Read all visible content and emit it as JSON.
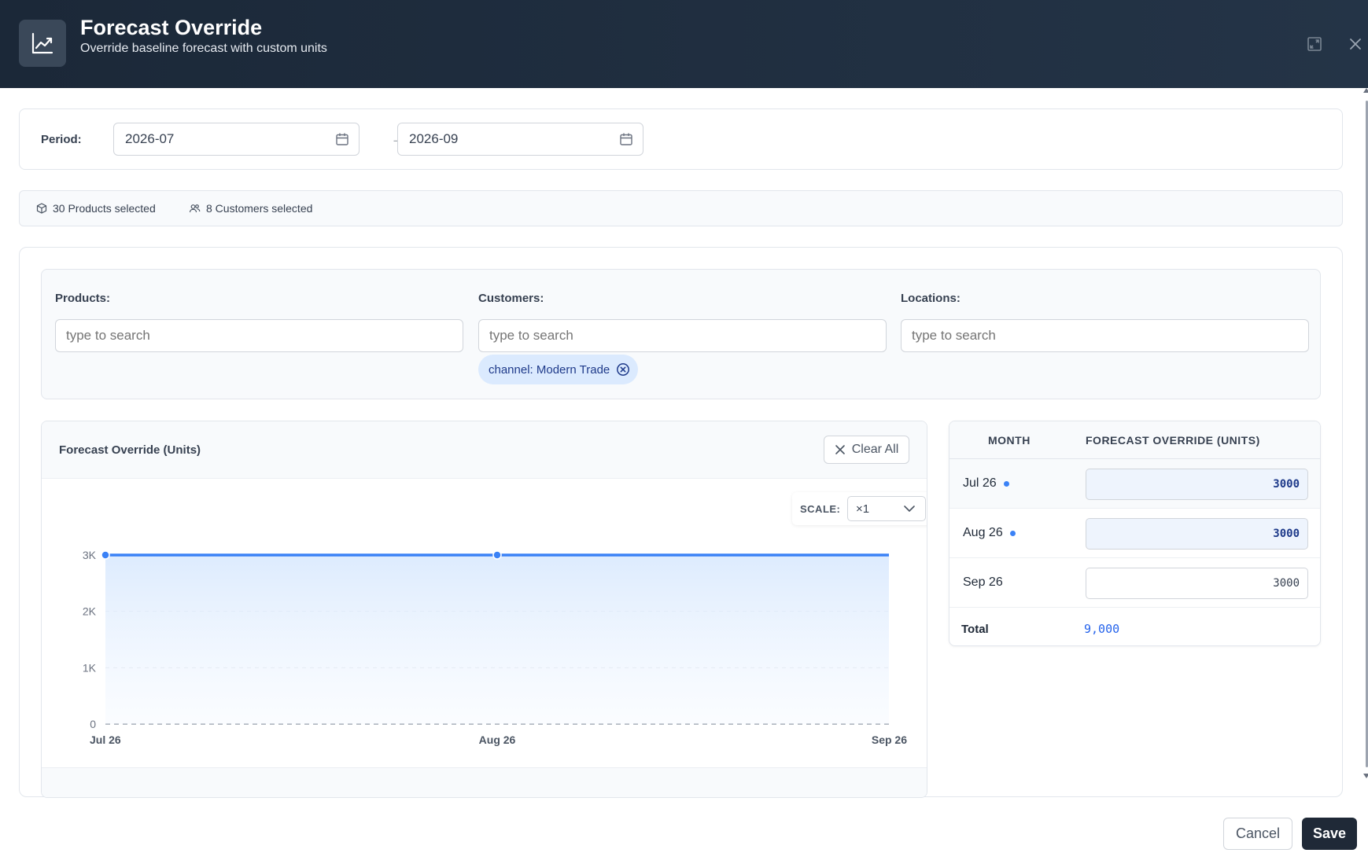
{
  "header": {
    "title": "Forecast Override",
    "subtitle": "Override baseline forecast with custom units",
    "icon": "trending-up-chart-icon",
    "actions": [
      "expand-icon",
      "close-icon"
    ]
  },
  "period": {
    "label": "Period:",
    "start": "2026-07",
    "arrow": "→",
    "end": "2026-09"
  },
  "selection": {
    "products": "30 Products selected",
    "customers": "8 Customers selected"
  },
  "filters": {
    "products": {
      "label": "Products:",
      "placeholder": "type to search"
    },
    "customers": {
      "label": "Customers:",
      "placeholder": "type to search",
      "chip": "channel: Modern Trade"
    },
    "locations": {
      "label": "Locations:",
      "placeholder": "type to search"
    }
  },
  "chart": {
    "title": "Forecast Override (Units)",
    "clear_label": "Clear All",
    "scale_label": "SCALE:",
    "scale_value": "×1",
    "y_tick_labels": [
      "0",
      "1K",
      "2K",
      "3K"
    ]
  },
  "chart_data": {
    "type": "area",
    "categories": [
      "Jul 26",
      "Aug 26",
      "Sep 26"
    ],
    "series": [
      {
        "values": [
          3000,
          3000,
          3000
        ]
      }
    ],
    "title": "Forecast Override (Units)",
    "ylim": [
      0,
      3000
    ],
    "y_ticks": [
      0,
      1000,
      2000,
      3000
    ],
    "grid": true,
    "line_color": "#3b82f6",
    "fill_color": "#dbeafe"
  },
  "table": {
    "col_month": "MONTH",
    "col_value": "FORECAST OVERRIDE (UNITS)",
    "rows": [
      {
        "month": "Jul 26",
        "value": "3000",
        "modified": true
      },
      {
        "month": "Aug 26",
        "value": "3000",
        "modified": true
      },
      {
        "month": "Sep 26",
        "value": "3000",
        "modified": false
      }
    ],
    "total_label": "Total",
    "total_value": "9,000"
  },
  "footer": {
    "cancel": "Cancel",
    "save": "Save"
  }
}
